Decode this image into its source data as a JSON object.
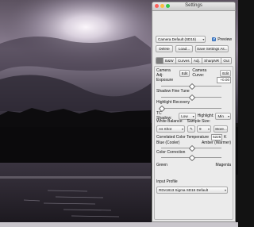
{
  "window": {
    "title": "Settings"
  },
  "preset": {
    "value": "Camera Default (SD15)",
    "preview_label": "Preview"
  },
  "toolbar": {
    "delete": "Delete",
    "load": "Load...",
    "save_as": "Save Settings As..."
  },
  "tabs": [
    "",
    "B&W",
    "Curves",
    "Adj.",
    "SharpNR",
    "Out"
  ],
  "active_tab": 0,
  "camera_adj": {
    "label": "Camera Adj:",
    "edit": "Edit",
    "curve_label": "Camera Curve:",
    "curve_edit": "Edit"
  },
  "exposure": {
    "label": "Exposure",
    "value": "+0.00",
    "position": 0.5
  },
  "shadow_fine_tune": {
    "label": "Shadow Fine Tune",
    "position": 0.5
  },
  "highlight_recovery": {
    "label": "Highlight Recovery",
    "position": 0.0
  },
  "tc": {
    "shadow_label": "TC Shadow:",
    "shadow_value": "Low",
    "highlight_label": "Highlight:",
    "highlight_value": "Min"
  },
  "white_balance": {
    "label": "White Balance:",
    "sample_label": "Sample Size:",
    "value": "As Shot",
    "sample_value": "9",
    "store": "Store..."
  },
  "color_temp": {
    "label": "Correlated Color Temperature",
    "value": "5225",
    "unit": "K",
    "position": 0.5
  },
  "tint": {
    "left": "Blue (Cooler)",
    "right": "Amber (Warmer)"
  },
  "color_correction": {
    "label": "Color Correction",
    "position": 0.5
  },
  "green_magenta": {
    "left": "Green",
    "right": "Magenta"
  },
  "input_profile": {
    "label": "Input Profile",
    "value": "RDv1813 Sigma SD15 Default"
  },
  "colors": {
    "close": "#fc605b",
    "minimize": "#fdbc40",
    "zoom": "#34c84a",
    "active_tab": "#7d7d7d"
  }
}
